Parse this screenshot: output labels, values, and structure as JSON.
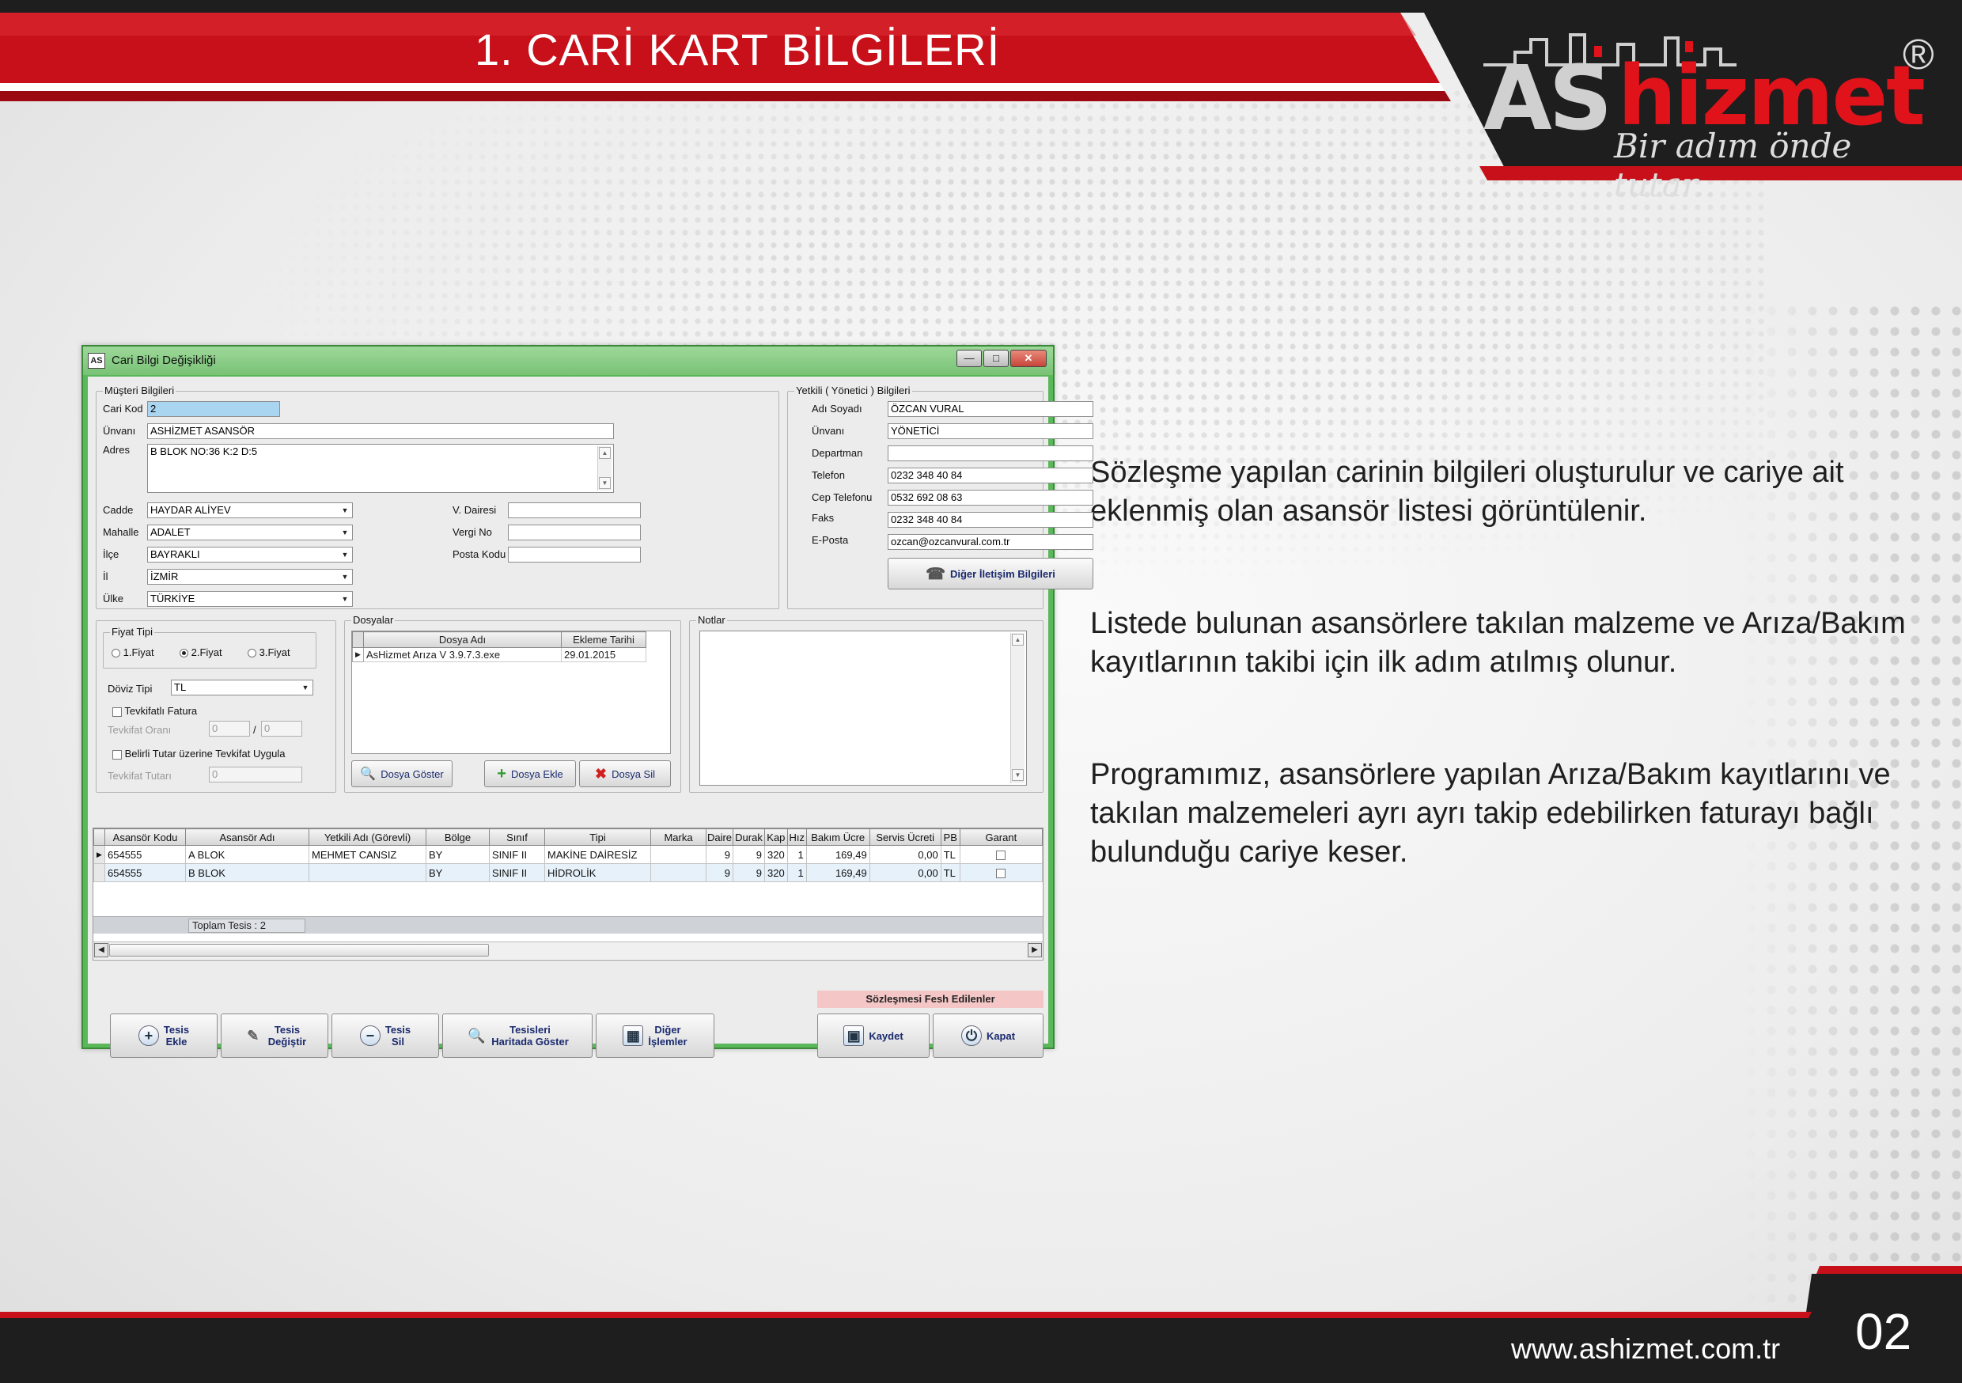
{
  "slide": {
    "title": "1. CARİ KART BİLGİLERİ",
    "logo": {
      "as": "AS",
      "hizmet": "hizmet",
      "reg": "®",
      "slogan": "Bir adım önde tutar.."
    },
    "footer_url": "www.ashizmet.com.tr",
    "page_number": "02",
    "paragraphs": [
      "Sözleşme yapılan carinin bilgileri oluşturulur ve cariye ait eklenmiş olan asansör listesi görüntülenir.",
      "Listede bulunan asansörlere takılan malzeme ve Arıza/Bakım kayıtlarının takibi için ilk adım atılmış olunur.",
      "Programımız, asansörlere yapılan Arıza/Bakım kayıtlarını ve takılan malzemeleri ayrı ayrı takip edebilirken faturayı bağlı bulunduğu cariye keser."
    ],
    "colors": {
      "brand_red": "#c8101a",
      "dark": "#1e1e1e",
      "window_frame": "#5ab85a"
    }
  },
  "window": {
    "icon_text": "AS",
    "title": "Cari Bilgi Değişikliği",
    "controls": {
      "minimize": "—",
      "maximize": "□",
      "close": "✕"
    }
  },
  "musteri": {
    "legend": "Müşteri Bilgileri",
    "cari_kod": {
      "label": "Cari Kod",
      "value": "2"
    },
    "unvan": {
      "label": "Ünvanı",
      "value": "ASHİZMET ASANSÖR"
    },
    "adres": {
      "label": "Adres",
      "value": "B BLOK NO:36 K:2 D:5"
    },
    "cadde": {
      "label": "Cadde",
      "value": "HAYDAR ALİYEV"
    },
    "mahalle": {
      "label": "Mahalle",
      "value": "ADALET"
    },
    "ilce": {
      "label": "İlçe",
      "value": "BAYRAKLI"
    },
    "il": {
      "label": "İl",
      "value": "İZMİR"
    },
    "ulke": {
      "label": "Ülke",
      "value": "TÜRKİYE"
    },
    "vergi_dairesi": {
      "label": "V. Dairesi",
      "value": ""
    },
    "vergi_no": {
      "label": "Vergi No",
      "value": ""
    },
    "posta_kodu": {
      "label": "Posta Kodu",
      "value": ""
    }
  },
  "yetkili": {
    "legend": "Yetkili ( Yönetici ) Bilgileri",
    "adi_soyadi": {
      "label": "Adı Soyadı",
      "value": "ÖZCAN VURAL"
    },
    "unvan": {
      "label": "Ünvanı",
      "value": "YÖNETİCİ"
    },
    "departman": {
      "label": "Departman",
      "value": ""
    },
    "telefon": {
      "label": "Telefon",
      "value": "0232 348 40 84"
    },
    "cep": {
      "label": "Cep Telefonu",
      "value": "0532 692 08 63"
    },
    "faks": {
      "label": "Faks",
      "value": "0232 348 40 84"
    },
    "eposta": {
      "label": "E-Posta",
      "value": "ozcan@ozcanvural.com.tr"
    },
    "diger_button": "Diğer İletişim Bilgileri"
  },
  "fiyat": {
    "legend": "Fiyat Tipi",
    "options": [
      "1.Fiyat",
      "2.Fiyat",
      "3.Fiyat"
    ],
    "selected": "2.Fiyat",
    "doviz": {
      "label": "Döviz Tipi",
      "value": "TL"
    },
    "tevkifatli_fatura": "Tevkifatlı Fatura",
    "tevkifat_orani": {
      "label": "Tevkifat Oranı",
      "value1": "0",
      "sep": "/",
      "value2": "0"
    },
    "belirli_tutar": "Belirli Tutar üzerine Tevkifat Uygula",
    "tevkifat_tutari": {
      "label": "Tevkifat Tutarı",
      "value": "0"
    }
  },
  "dosyalar": {
    "legend": "Dosyalar",
    "headers": [
      "Dosya Adı",
      "Ekleme Tarihi"
    ],
    "rows": [
      [
        "AsHizmet Arıza V 3.9.7.3.exe",
        "29.01.2015"
      ]
    ],
    "buttons": {
      "goster": "Dosya Göster",
      "ekle": "Dosya Ekle",
      "sil": "Dosya Sil"
    }
  },
  "notlar": {
    "legend": "Notlar",
    "value": ""
  },
  "grid": {
    "headers": [
      "Asansör Kodu",
      "Asansör Adı",
      "Yetkili Adı (Görevli)",
      "Bölge",
      "Sınıf",
      "Tipi",
      "Marka",
      "Daire",
      "Durak",
      "Kap",
      "Hız",
      "Bakım Ücre",
      "Servis Ücreti",
      "PB",
      "Garant"
    ],
    "rows": [
      [
        "654555",
        "A BLOK",
        "MEHMET CANSIZ",
        "BY",
        "SINIF II",
        "MAKİNE DAİRESİZ",
        "",
        "9",
        "9",
        "320",
        "1",
        "169,49",
        "0,00",
        "TL"
      ],
      [
        "654555",
        "B BLOK",
        "",
        "BY",
        "SINIF II",
        "HİDROLİK",
        "",
        "9",
        "9",
        "320",
        "1",
        "169,49",
        "0,00",
        "TL"
      ]
    ],
    "total_label": "Toplam Tesis : 2"
  },
  "fesh_label": "Sözleşmesi Fesh Edilenler",
  "bottom_buttons": {
    "tesis_ekle": [
      "Tesis",
      "Ekle"
    ],
    "tesis_degistir": [
      "Tesis",
      "Değiştir"
    ],
    "tesis_sil": [
      "Tesis",
      "Sil"
    ],
    "haritada": [
      "Tesisleri",
      "Haritada Göster"
    ],
    "diger": [
      "Diğer",
      "İşlemler"
    ],
    "kaydet": "Kaydet",
    "kapat": "Kapat"
  }
}
